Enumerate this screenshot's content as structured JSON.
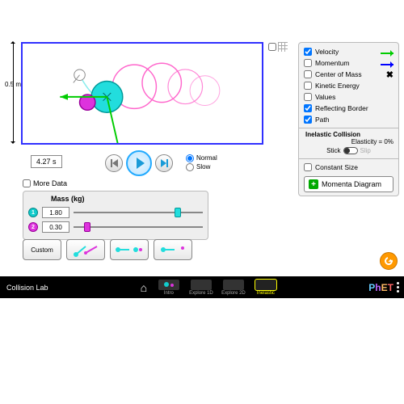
{
  "app": {
    "title": "Collision Lab"
  },
  "axis": {
    "y_label": "0.5 m"
  },
  "time": {
    "display": "4.27 s"
  },
  "speed": {
    "normal": "Normal",
    "slow": "Slow",
    "selected": "normal"
  },
  "options": {
    "velocity": "Velocity",
    "momentum": "Momentum",
    "center_of_mass": "Center of Mass",
    "kinetic_energy": "Kinetic Energy",
    "values": "Values",
    "reflecting_border": "Reflecting Border",
    "path": "Path",
    "inelastic_heading": "Inelastic Collision",
    "elasticity": "Elasticity = 0%",
    "stick": "Stick",
    "slip": "Slip",
    "constant_size": "Constant Size",
    "momenta_diagram": "Momenta Diagram"
  },
  "more_data": {
    "label": "More Data"
  },
  "mass_panel": {
    "heading": "Mass (kg)",
    "ball1": {
      "id": "1",
      "value": "1.80"
    },
    "ball2": {
      "id": "2",
      "value": "0.30"
    }
  },
  "presets": {
    "custom": "Custom"
  },
  "nav": {
    "intro": "Intro",
    "explore1d": "Explore 1D",
    "explore2d": "Explore 2D",
    "inelastic": "Inelastic"
  }
}
